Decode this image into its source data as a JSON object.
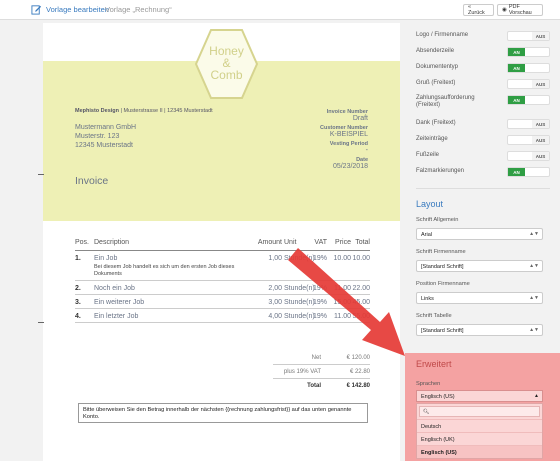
{
  "topbar": {
    "title": "Vorlage bearbeiten",
    "subtitle": "Vorlage „Rechnung“",
    "back_label": "« Zurück",
    "pdf_label": "PDF Vorschau"
  },
  "document": {
    "logo_text": [
      "Honey",
      "&",
      "Comb"
    ],
    "sender_name": "Mephisto Design",
    "sender_address": "Musterstrasse II | 12345 Musterstadt",
    "recipient": [
      "Mustermann GmbH",
      "Musterstr. 123",
      "12345 Musterstadt"
    ],
    "doc_title": "Invoice",
    "meta": [
      {
        "label": "Invoice Number",
        "value": "Draft"
      },
      {
        "label": "Customer Number",
        "value": "K-BEISPIEL"
      },
      {
        "label": "Vesting Period",
        "value": "-"
      },
      {
        "label": "Date",
        "value": "05/23/2018"
      }
    ],
    "table": {
      "headers": [
        "Pos.",
        "Description",
        "Amount",
        "Unit",
        "VAT",
        "Price",
        "Total"
      ],
      "rows": [
        {
          "pos": "1.",
          "desc": "Ein Job",
          "sub": "Bei diesem Job handelt es sich um den ersten Job dieses Dokuments",
          "amount": "1,00",
          "unit": "Stunde(n)",
          "vat": "19%",
          "price": "10.00",
          "total": "10.00"
        },
        {
          "pos": "2.",
          "desc": "Noch ein Job",
          "sub": "",
          "amount": "2,00",
          "unit": "Stunde(n)",
          "vat": "19%",
          "price": "11.00",
          "total": "22.00"
        },
        {
          "pos": "3.",
          "desc": "Ein weiterer Job",
          "sub": "",
          "amount": "3,00",
          "unit": "Stunde(n)",
          "vat": "19%",
          "price": "15.00",
          "total": "45.00"
        },
        {
          "pos": "4.",
          "desc": "Ein letzter Job",
          "sub": "",
          "amount": "4,00",
          "unit": "Stunde(n)",
          "vat": "19%",
          "price": "11.00",
          "total": "55.00"
        }
      ]
    },
    "totals": [
      {
        "label": "Net",
        "value": "€ 120.00"
      },
      {
        "label": "plus 19% VAT",
        "value": "€ 22.80"
      },
      {
        "label": "Total",
        "value": "€ 142.80"
      }
    ],
    "note": "Bitte überweisen Sie den Betrag innerhalb der nächsten {{rechnung zahlungsfrist}} auf das unten genannte Konto."
  },
  "panel": {
    "toggles": [
      {
        "label": "Logo / Firmenname",
        "on": false,
        "text": "AUS"
      },
      {
        "label": "Absenderzeile",
        "on": true,
        "text": "AN"
      },
      {
        "label": "Dokumententyp",
        "on": true,
        "text": "AN"
      },
      {
        "label": "Gruß (Freitext)",
        "on": false,
        "text": "AUS"
      },
      {
        "label": "Zahlungsaufforderung (Freitext)",
        "on": true,
        "text": "AN"
      },
      {
        "label": "Dank (Freitext)",
        "on": false,
        "text": "AUS"
      },
      {
        "label": "Zeiteinträge",
        "on": false,
        "text": "AUS"
      },
      {
        "label": "Fußzeile",
        "on": false,
        "text": "AUS"
      },
      {
        "label": "Falzmarkierungen",
        "on": true,
        "text": "AN"
      }
    ],
    "layout_title": "Layout",
    "fields": [
      {
        "label": "Schrift Allgemein",
        "value": "Arial"
      },
      {
        "label": "Schrift Firmenname",
        "value": "[Standard Schrift]"
      },
      {
        "label": "Position Firmenname",
        "value": "Links"
      },
      {
        "label": "Schrift Tabelle",
        "value": "[Standard Schrift]"
      }
    ],
    "advanced_title": "Erweitert",
    "language_label": "Sprachen",
    "language_value": "Englisch (US)",
    "language_options": [
      "Deutsch",
      "Englisch (UK)",
      "Englisch (US)"
    ],
    "selected_language": "Englisch (US)"
  },
  "colors": {
    "accent": "#3a7bbf",
    "header_band": "#eef0b5",
    "toggle_on": "#2f9e44",
    "highlight": "#f4a2a2",
    "arrow": "#e53935"
  }
}
